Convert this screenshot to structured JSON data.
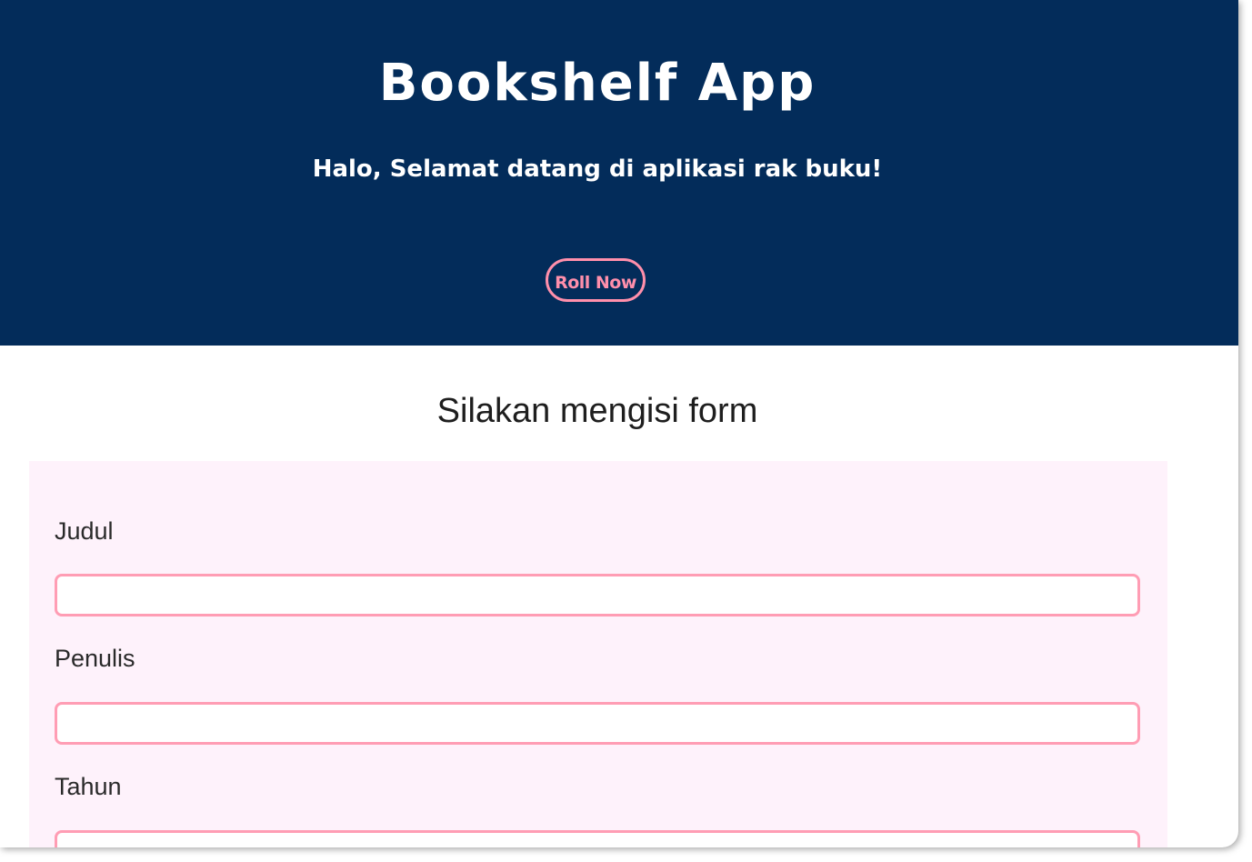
{
  "header": {
    "title": "Bookshelf App",
    "subtitle": "Halo, Selamat datang di aplikasi rak buku!",
    "cta_label": "Roll Now"
  },
  "form": {
    "heading": "Silakan mengisi form",
    "fields": [
      {
        "label": "Judul",
        "value": ""
      },
      {
        "label": "Penulis",
        "value": ""
      },
      {
        "label": "Tahun",
        "value": ""
      }
    ]
  },
  "colors": {
    "hero_background": "#032c5a",
    "accent": "#ff8fab",
    "form_background": "#fef2fb"
  }
}
